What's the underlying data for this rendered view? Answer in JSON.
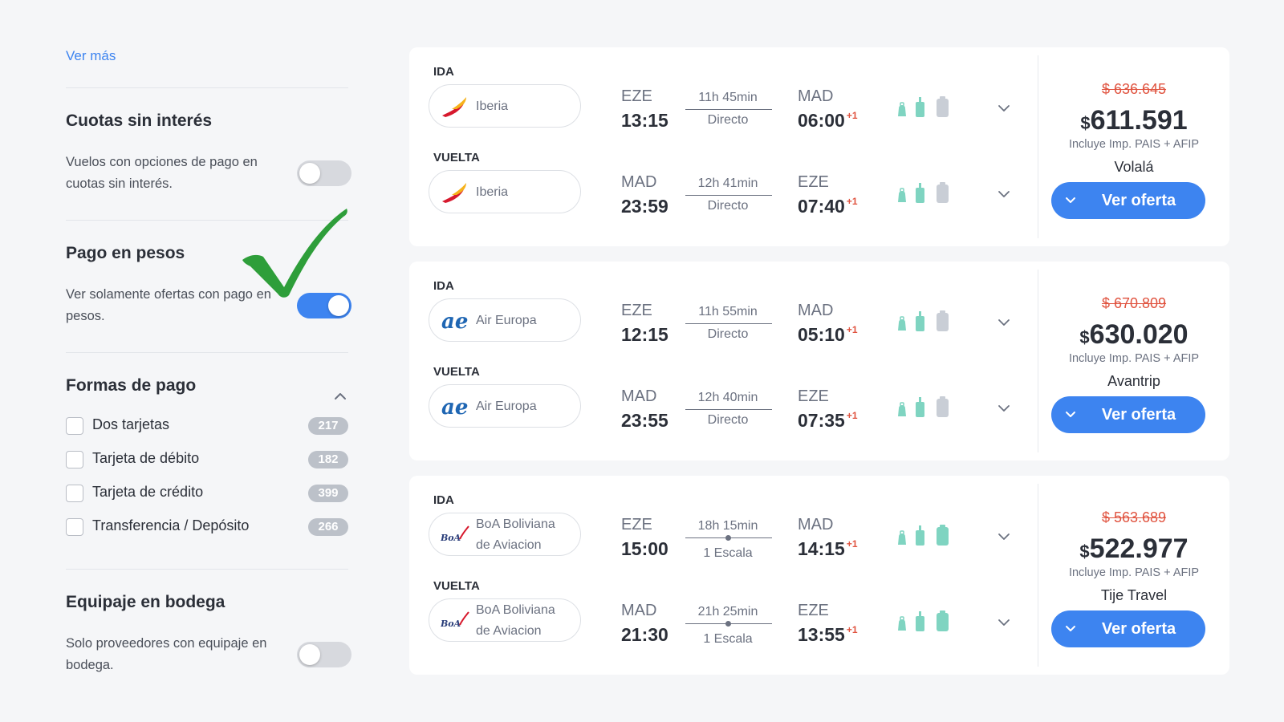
{
  "sidebar": {
    "ver_mas": "Ver más",
    "cuotas": {
      "title": "Cuotas sin interés",
      "desc": "Vuelos con opciones de pago en cuotas sin interés.",
      "enabled": false
    },
    "pesos": {
      "title": "Pago en pesos",
      "desc": "Ver solamente ofertas con pago en pesos.",
      "enabled": true
    },
    "formas": {
      "title": "Formas de pago",
      "items": [
        {
          "label": "Dos tarjetas",
          "count": "217"
        },
        {
          "label": "Tarjeta de débito",
          "count": "182"
        },
        {
          "label": "Tarjeta de crédito",
          "count": "399"
        },
        {
          "label": "Transferencia / Depósito",
          "count": "266"
        }
      ]
    },
    "equipaje": {
      "title": "Equipaje en bodega",
      "desc": "Solo proveedores con equipaje en bodega.",
      "enabled": false
    }
  },
  "results": [
    {
      "legs": [
        {
          "label": "IDA",
          "airline": "Iberia",
          "from": "EZE",
          "dep": "13:15",
          "duration": "11h 45min",
          "stops": "Directo",
          "to": "MAD",
          "arr": "06:00",
          "plus": "+1"
        },
        {
          "label": "VUELTA",
          "airline": "Iberia",
          "from": "MAD",
          "dep": "23:59",
          "duration": "12h 41min",
          "stops": "Directo",
          "to": "EZE",
          "arr": "07:40",
          "plus": "+1"
        }
      ],
      "price_old": "$ 636.645",
      "currency": "$",
      "price": "611.591",
      "tax": "Incluye Imp. PAIS + AFIP",
      "provider": "Volalá",
      "cta": "Ver oferta"
    },
    {
      "legs": [
        {
          "label": "IDA",
          "airline": "Air Europa",
          "from": "EZE",
          "dep": "12:15",
          "duration": "11h 55min",
          "stops": "Directo",
          "to": "MAD",
          "arr": "05:10",
          "plus": "+1"
        },
        {
          "label": "VUELTA",
          "airline": "Air Europa",
          "from": "MAD",
          "dep": "23:55",
          "duration": "12h 40min",
          "stops": "Directo",
          "to": "EZE",
          "arr": "07:35",
          "plus": "+1"
        }
      ],
      "price_old": "$ 670.809",
      "currency": "$",
      "price": "630.020",
      "tax": "Incluye Imp. PAIS + AFIP",
      "provider": "Avantrip",
      "cta": "Ver oferta"
    },
    {
      "legs": [
        {
          "label": "IDA",
          "airline": "BoA Boliviana de Aviacion",
          "from": "EZE",
          "dep": "15:00",
          "duration": "18h 15min",
          "stops": "1 Escala",
          "to": "MAD",
          "arr": "14:15",
          "plus": "+1"
        },
        {
          "label": "VUELTA",
          "airline": "BoA Boliviana de Aviacion",
          "from": "MAD",
          "dep": "21:30",
          "duration": "21h 25min",
          "stops": "1 Escala",
          "to": "EZE",
          "arr": "13:55",
          "plus": "+1"
        }
      ],
      "price_old": "$ 563.689",
      "currency": "$",
      "price": "522.977",
      "tax": "Incluye Imp. PAIS + AFIP",
      "provider": "Tije Travel",
      "cta": "Ver oferta"
    }
  ],
  "colors": {
    "accent": "#3d84f0",
    "strike": "#e0533f",
    "bag_included": "#7fd4c1",
    "bag_excluded": "#c9ced6",
    "check": "#2e9e3a"
  }
}
